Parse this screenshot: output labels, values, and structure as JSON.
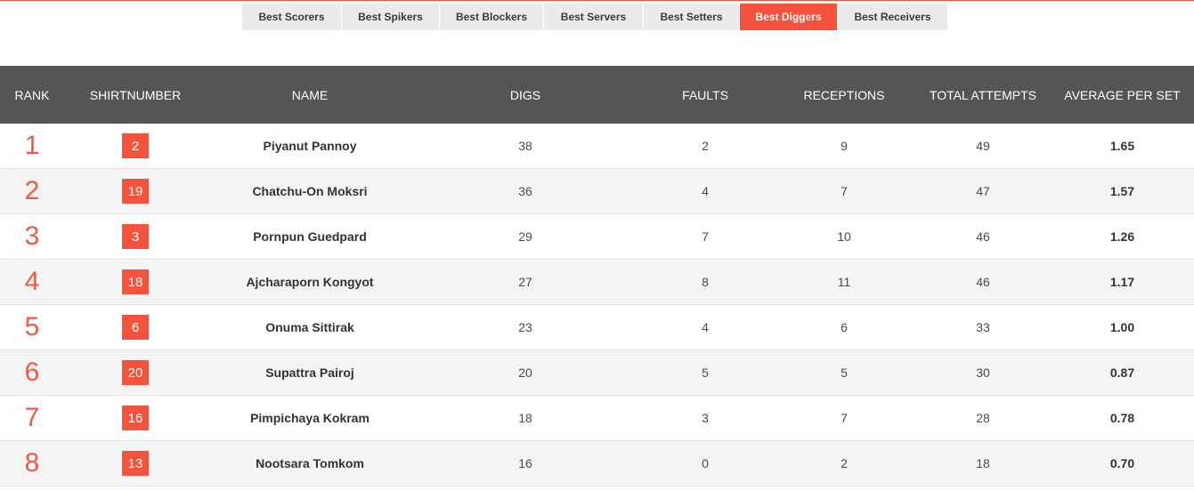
{
  "tabs": [
    {
      "label": "Best Scorers",
      "active": false
    },
    {
      "label": "Best Spikers",
      "active": false
    },
    {
      "label": "Best Blockers",
      "active": false
    },
    {
      "label": "Best Servers",
      "active": false
    },
    {
      "label": "Best Setters",
      "active": false
    },
    {
      "label": "Best Diggers",
      "active": true
    },
    {
      "label": "Best Receivers",
      "active": false
    }
  ],
  "headers": {
    "rank": "RANK",
    "shirt": "SHIRTNUMBER",
    "name": "NAME",
    "digs": "DIGS",
    "faults": "FAULTS",
    "receptions": "RECEPTIONS",
    "total": "TOTAL ATTEMPTS",
    "avg": "AVERAGE PER SET"
  },
  "rows": [
    {
      "rank": "1",
      "shirt": "2",
      "name": "Piyanut Pannoy",
      "digs": "38",
      "faults": "2",
      "receptions": "9",
      "total": "49",
      "avg": "1.65"
    },
    {
      "rank": "2",
      "shirt": "19",
      "name": "Chatchu-On Moksri",
      "digs": "36",
      "faults": "4",
      "receptions": "7",
      "total": "47",
      "avg": "1.57"
    },
    {
      "rank": "3",
      "shirt": "3",
      "name": "Pornpun Guedpard",
      "digs": "29",
      "faults": "7",
      "receptions": "10",
      "total": "46",
      "avg": "1.26"
    },
    {
      "rank": "4",
      "shirt": "18",
      "name": "Ajcharaporn Kongyot",
      "digs": "27",
      "faults": "8",
      "receptions": "11",
      "total": "46",
      "avg": "1.17"
    },
    {
      "rank": "5",
      "shirt": "6",
      "name": "Onuma Sittirak",
      "digs": "23",
      "faults": "4",
      "receptions": "6",
      "total": "33",
      "avg": "1.00"
    },
    {
      "rank": "6",
      "shirt": "20",
      "name": "Supattra Pairoj",
      "digs": "20",
      "faults": "5",
      "receptions": "5",
      "total": "30",
      "avg": "0.87"
    },
    {
      "rank": "7",
      "shirt": "16",
      "name": "Pimpichaya Kokram",
      "digs": "18",
      "faults": "3",
      "receptions": "7",
      "total": "28",
      "avg": "0.78"
    },
    {
      "rank": "8",
      "shirt": "13",
      "name": "Nootsara Tomkom",
      "digs": "16",
      "faults": "0",
      "receptions": "2",
      "total": "18",
      "avg": "0.70"
    }
  ],
  "colors": {
    "accent": "#f5533d",
    "header_bg": "#555555",
    "tab_bg": "#ebebeb"
  }
}
